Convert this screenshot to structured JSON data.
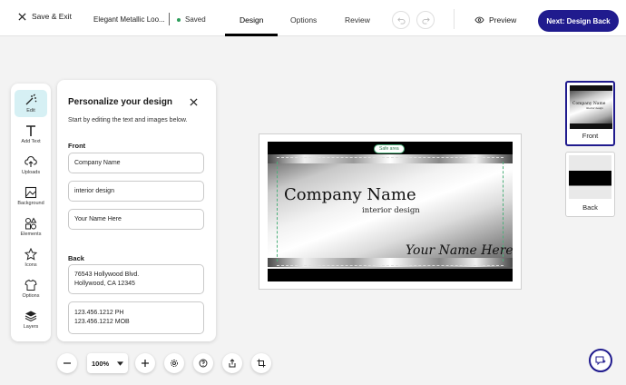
{
  "header": {
    "save_exit": "Save & Exit",
    "doc_title": "Elegant Metallic Loo...",
    "saved": "Saved",
    "tabs": [
      {
        "label": "Design",
        "active": true
      },
      {
        "label": "Options",
        "active": false
      },
      {
        "label": "Review",
        "active": false
      }
    ],
    "preview": "Preview",
    "next": "Next: Design Back"
  },
  "tools": [
    {
      "label": "Edit",
      "icon": "edit-wand-icon",
      "active": true
    },
    {
      "label": "Add Text",
      "icon": "text-icon",
      "active": false
    },
    {
      "label": "Uploads",
      "icon": "upload-cloud-icon",
      "active": false
    },
    {
      "label": "Background",
      "icon": "image-icon",
      "active": false
    },
    {
      "label": "Elements",
      "icon": "shapes-icon",
      "active": false
    },
    {
      "label": "Icons",
      "icon": "star-icon",
      "active": false
    },
    {
      "label": "Options",
      "icon": "shirt-icon",
      "active": false
    },
    {
      "label": "Layers",
      "icon": "layers-icon",
      "active": false
    }
  ],
  "panel": {
    "title": "Personalize your design",
    "subtitle": "Start by editing the text and images below.",
    "front_label": "Front",
    "front_fields": [
      "Company Name",
      "interior design",
      "Your Name Here"
    ],
    "back_label": "Back",
    "back_fields": [
      [
        "76543 Hollywood Blvd.",
        "Hollywood, CA 12345"
      ],
      [
        "123.456.1212 PH",
        "123.456.1212 MOB"
      ]
    ]
  },
  "card": {
    "safe_area": "Safe area",
    "company": "Company Name",
    "tagline": "interior design",
    "name": "Your Name Here"
  },
  "thumbnails": [
    {
      "label": "Front",
      "selected": true,
      "preview_text": [
        "Company Name",
        "interior design"
      ]
    },
    {
      "label": "Back",
      "selected": false
    }
  ],
  "bottom": {
    "zoom": "100%"
  },
  "colors": {
    "accent": "#201b8e",
    "saved_dot": "#2e9e5b",
    "active_tool_bg": "#d6f0f4",
    "safe_area": "#4caf7a"
  }
}
